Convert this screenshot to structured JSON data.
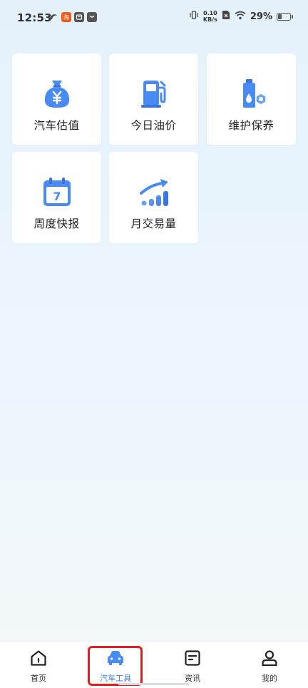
{
  "status_bar": {
    "time": "12:53",
    "net_speed_value": "0.10",
    "net_speed_unit": "KB/s",
    "battery_percent": "29%"
  },
  "tools": [
    {
      "label": "汽车估值",
      "icon": "money-bag-yuan-icon"
    },
    {
      "label": "今日油价",
      "icon": "fuel-pump-icon"
    },
    {
      "label": "维护保养",
      "icon": "oil-bottle-hex-nut-icon"
    },
    {
      "label": "周度快报",
      "icon": "calendar-icon",
      "calendar_day": "7"
    },
    {
      "label": "月交易量",
      "icon": "trend-chart-icon"
    }
  ],
  "bottom_nav": {
    "items": [
      {
        "label": "首页",
        "icon": "home-icon"
      },
      {
        "label": "汽车工具",
        "icon": "car-icon",
        "active": true
      },
      {
        "label": "资讯",
        "icon": "news-icon"
      },
      {
        "label": "我的",
        "icon": "profile-icon"
      }
    ]
  },
  "colors": {
    "accent": "#3d7cf0",
    "icon_blue": "#4a8af4",
    "highlight_red": "#e0201f"
  }
}
